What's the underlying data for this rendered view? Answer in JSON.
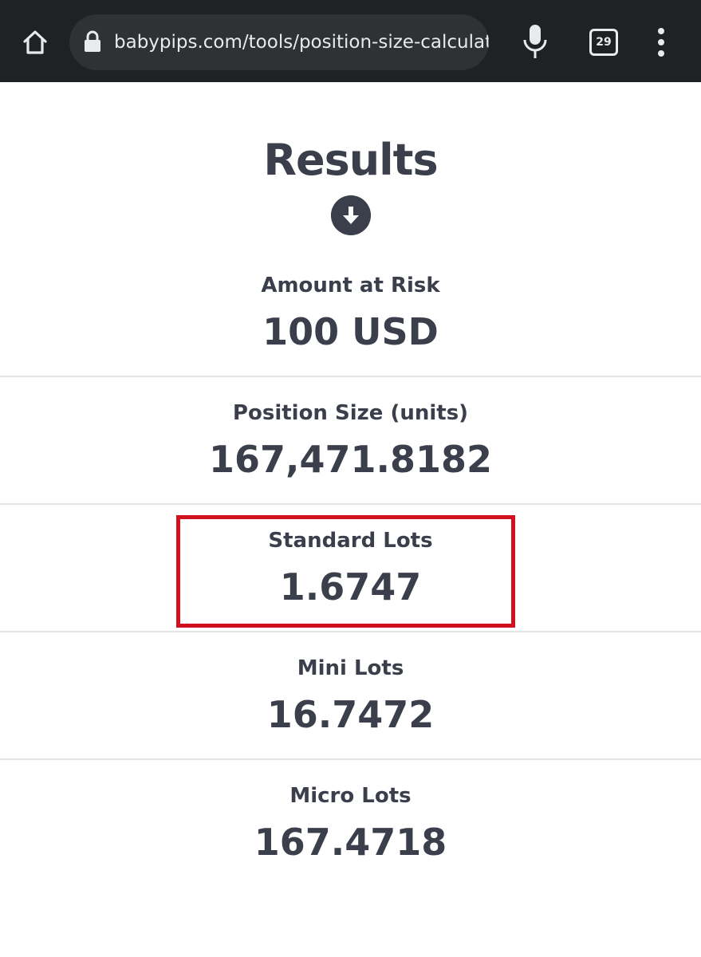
{
  "browser": {
    "url_main": "babypips.com/tools/position-size-calculat",
    "url_cutoff": "o",
    "tab_count": "29"
  },
  "results": {
    "title": "Results",
    "rows": [
      {
        "label": "Amount at Risk",
        "value": "100 USD"
      },
      {
        "label": "Position Size (units)",
        "value": "167,471.8182"
      },
      {
        "label": "Standard Lots",
        "value": "1.6747"
      },
      {
        "label": "Mini Lots",
        "value": "16.7472"
      },
      {
        "label": "Micro Lots",
        "value": "167.4718"
      }
    ]
  },
  "colors": {
    "text": "#3a3f4b",
    "highlight": "#d0101e",
    "browser_bar": "#202124"
  },
  "icons": [
    "home-icon",
    "lock-icon",
    "microphone-icon",
    "tabs-icon",
    "more-vert-icon",
    "arrow-down-circle-icon"
  ]
}
